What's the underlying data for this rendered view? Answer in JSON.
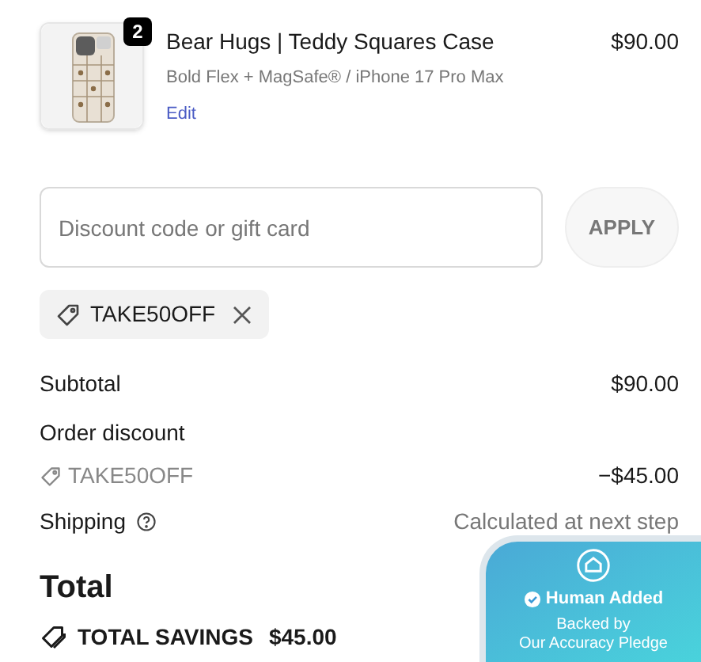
{
  "cart_item": {
    "quantity": "2",
    "title": "Bear Hugs | Teddy Squares Case",
    "variant": "Bold Flex + MagSafe® / iPhone 17 Pro Max",
    "edit_link": "Edit",
    "price": "$90.00"
  },
  "discount": {
    "placeholder": "Discount code or gift card",
    "apply_button": "APPLY",
    "applied_codes": [
      {
        "code": "TAKE50OFF"
      }
    ]
  },
  "summary": {
    "subtotal": {
      "label": "Subtotal",
      "value": "$90.00"
    },
    "order_discount": {
      "label": "Order discount",
      "code": "TAKE50OFF",
      "value": "−$45.00"
    },
    "shipping": {
      "label": "Shipping",
      "value": "Calculated at next step"
    },
    "total": {
      "label": "Total"
    },
    "savings": {
      "label": "TOTAL SAVINGS",
      "value": "$45.00"
    }
  },
  "badge": {
    "title": "Human Added",
    "line_1": "Backed by",
    "line_2": "Our Accuracy Pledge"
  }
}
